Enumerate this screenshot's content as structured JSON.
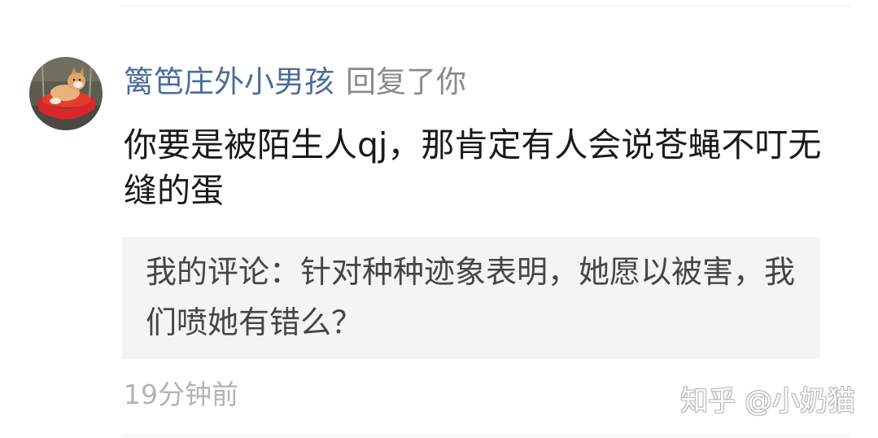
{
  "comment": {
    "avatar_icon": "shiba-dog-swing-avatar",
    "username": "篱笆庄外小男孩",
    "action_text": "回复了你",
    "body": "你要是被陌生人qj，那肯定有人会说苍蝇不叮无缝的蛋",
    "quoted_comment": "我的评论：针对种种迹象表明，她愿以被害，我们喷她有错么？",
    "timestamp": "19分钟前"
  },
  "watermark": "知乎 @小奶猫",
  "colors": {
    "username": "#4d6c99",
    "action_text": "#8a8a8a",
    "body_text": "#1a1a1a",
    "quote_background": "#f4f4f4",
    "timestamp": "#b3b3b3"
  }
}
